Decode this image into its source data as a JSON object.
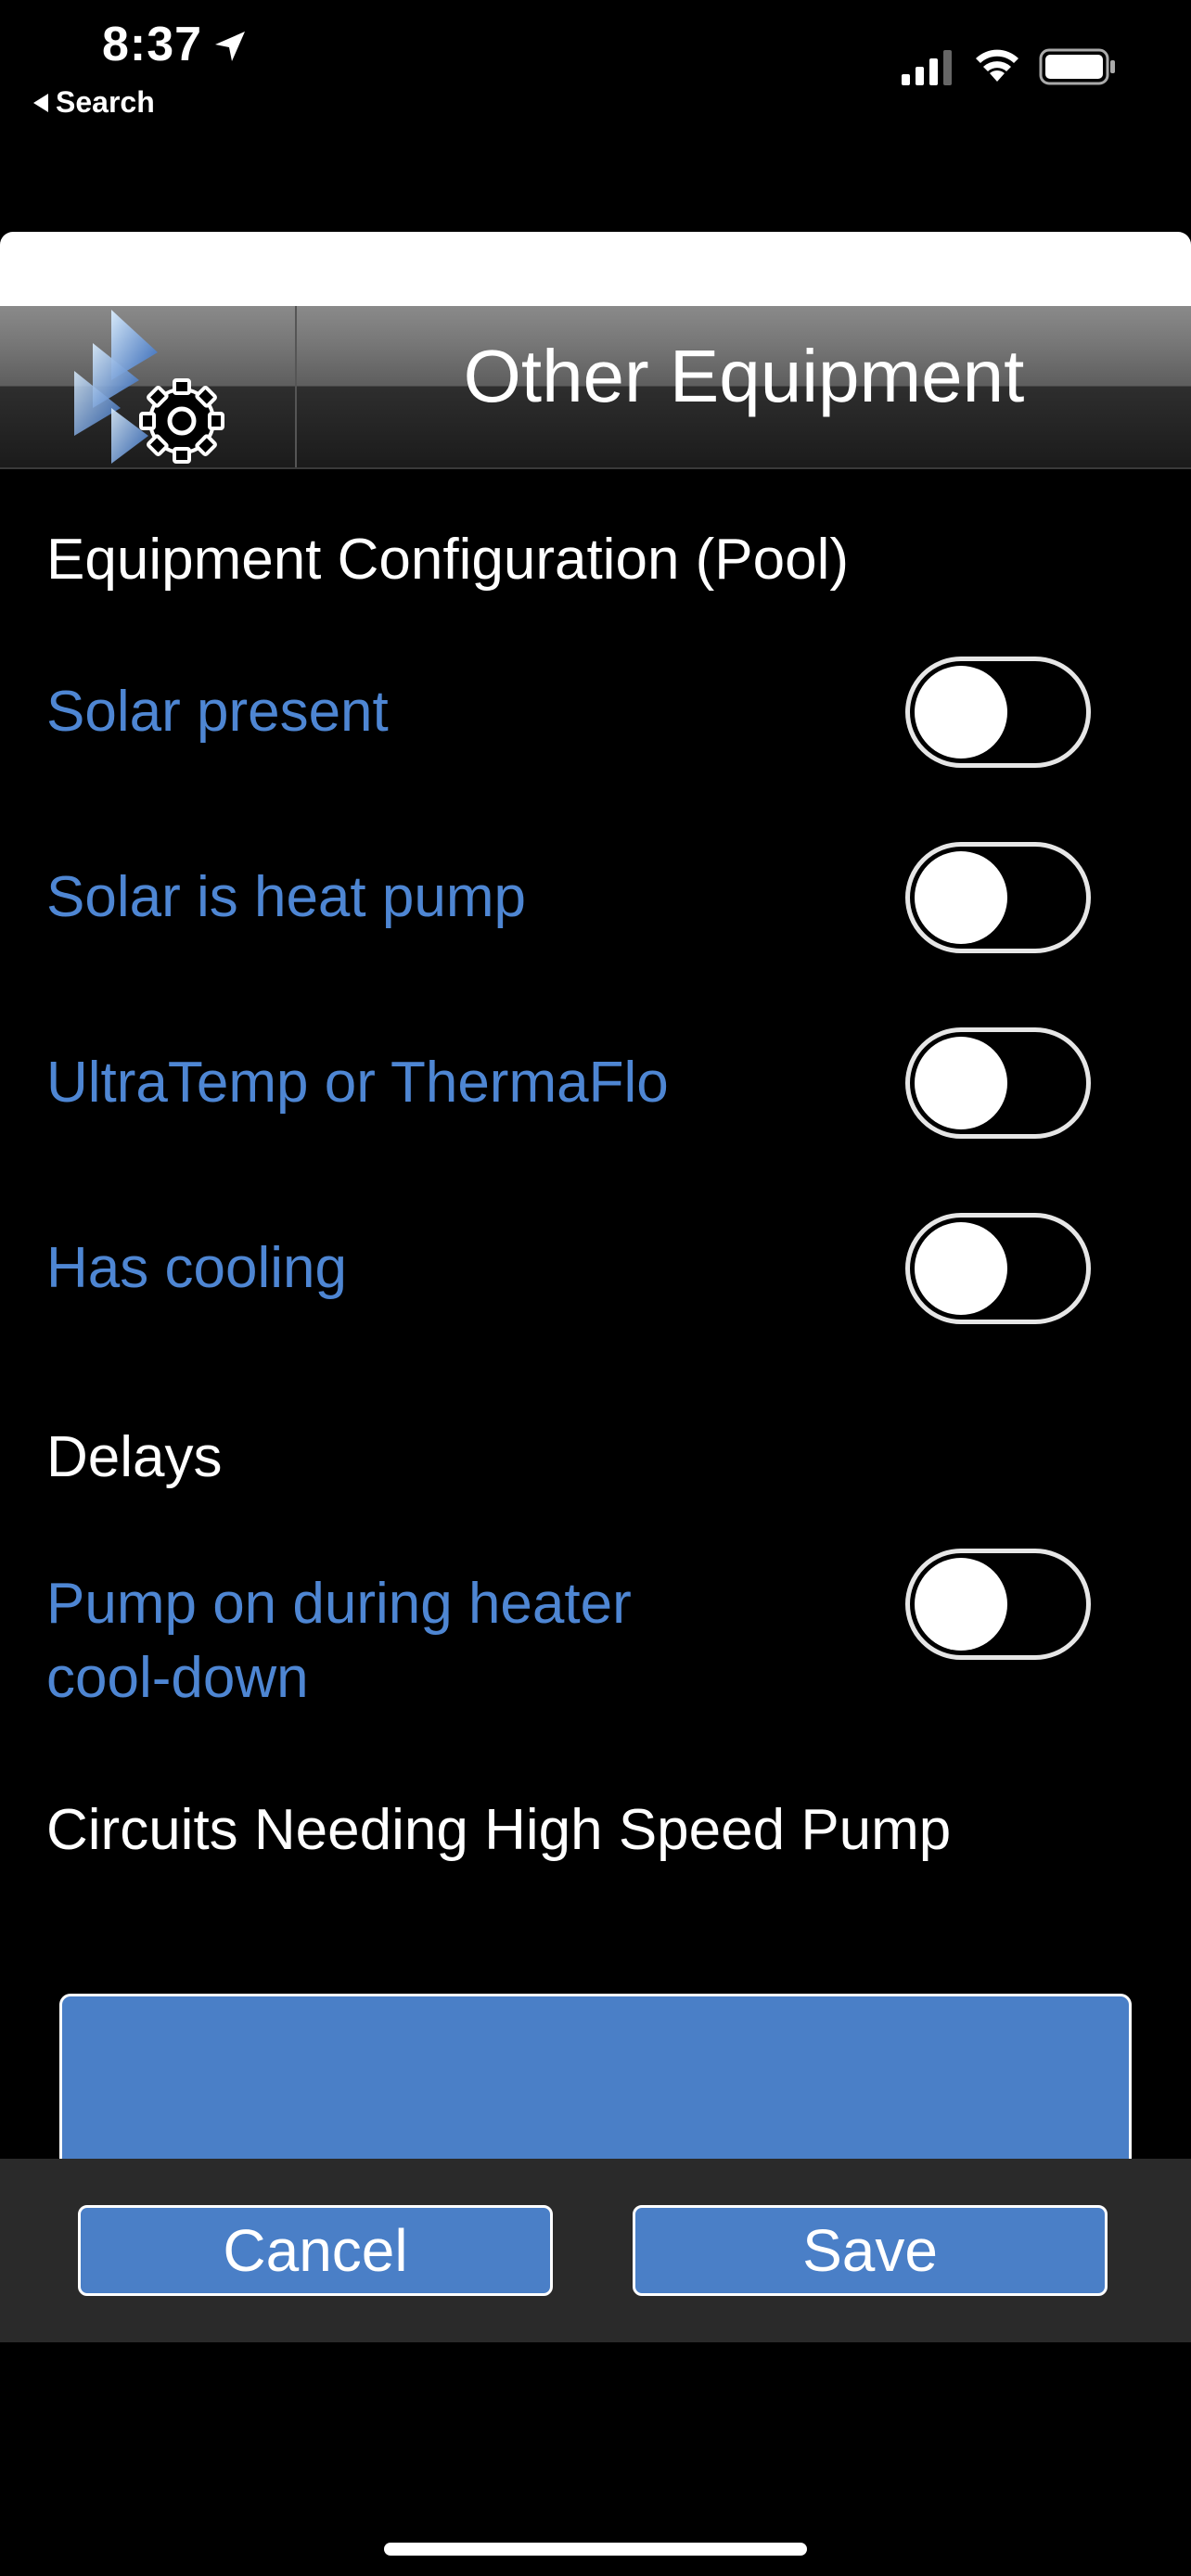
{
  "status_bar": {
    "time": "8:37",
    "back_label": "Search"
  },
  "header": {
    "title": "Other Equipment",
    "logo_icon": "pentair-gear-icon"
  },
  "sections": {
    "equipment_config": "Equipment Configuration (Pool)",
    "delays": "Delays",
    "high_speed": "Circuits Needing High Speed Pump"
  },
  "options": {
    "solar_present": {
      "label": "Solar present",
      "on": false
    },
    "solar_heat_pump": {
      "label": "Solar is heat pump",
      "on": false
    },
    "ultratemp": {
      "label": "UltraTemp or ThermaFlo",
      "on": false
    },
    "has_cooling": {
      "label": "Has cooling",
      "on": false
    },
    "pump_on_line1": "Pump on during heater",
    "pump_on_line2": "cool-down",
    "pump_on": {
      "on": false
    }
  },
  "footer": {
    "cancel_label": "Cancel",
    "save_label": "Save"
  },
  "colors": {
    "accent_blue": "#4e86d3",
    "button_blue": "#4a7fc7",
    "background": "#000000"
  }
}
